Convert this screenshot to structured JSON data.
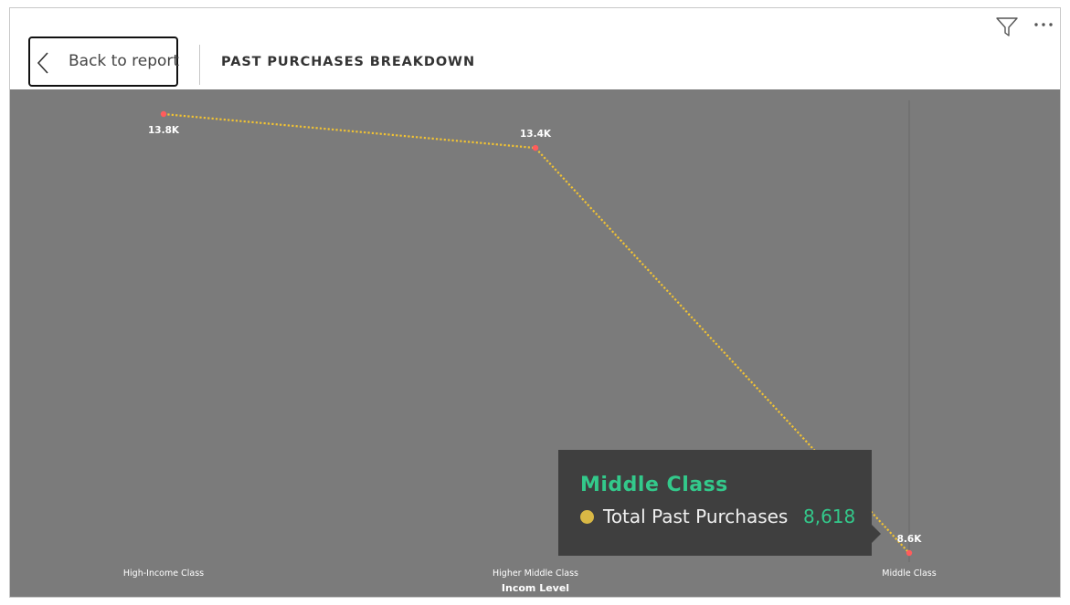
{
  "header": {
    "back_label": "Back to report",
    "title": "PAST PURCHASES BREAKDOWN"
  },
  "icons": {
    "back": "chevron-left-icon",
    "filter": "filter-icon",
    "more": "more-options-icon"
  },
  "colors": {
    "chart_bg": "#7b7b7b",
    "line": "#f2c333",
    "marker": "#ff5c5c",
    "tooltip_bg": "#3f3f3f",
    "tooltip_accent": "#33c98b",
    "tooltip_dot": "#d9b845"
  },
  "chart_data": {
    "type": "line",
    "categories": [
      "High-Income Class",
      "Higher Middle Class",
      "Middle Class"
    ],
    "values": [
      13800,
      13400,
      8618
    ],
    "data_labels": [
      "13.8K",
      "13.4K",
      "8.6K"
    ],
    "xlabel": "Incom Level",
    "ylabel": "",
    "ylim": [
      8618,
      13800
    ],
    "grid": false,
    "series": [
      {
        "values": [
          13800,
          13400,
          8618
        ]
      }
    ]
  },
  "tooltip": {
    "category": "Middle Class",
    "measure": "Total Past Purchases",
    "value": "8,618"
  }
}
